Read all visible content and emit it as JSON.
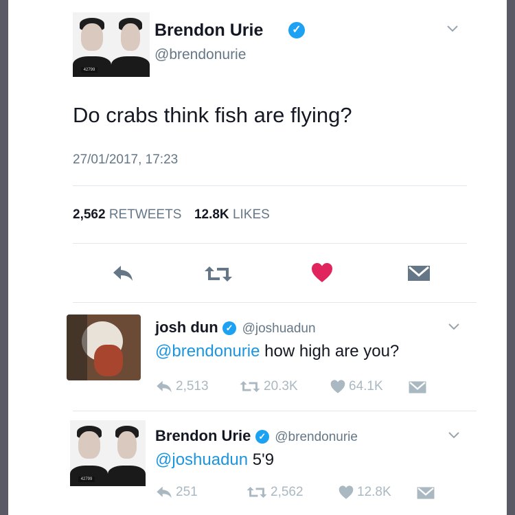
{
  "main_tweet": {
    "author_name": "Brendon Urie",
    "author_handle": "@brendonurie",
    "text": "Do crabs think fish are flying?",
    "timestamp": "27/01/2017, 17:23",
    "retweets_count": "2,562",
    "retweets_label": "RETWEETS",
    "likes_count": "12.8K",
    "likes_label": "LIKES",
    "icons": [
      "reply-icon",
      "retweet-icon",
      "like-icon-filled",
      "direct-message-icon",
      "chevron-down-icon",
      "verified-badge-icon"
    ],
    "colors": {
      "like": "#e0245e",
      "verified": "#1da1f2"
    }
  },
  "reply_1": {
    "author_name": "josh dun",
    "author_handle": "@joshuadun",
    "mention": "@brendonurie",
    "text": " how high are you?",
    "replies": "2,513",
    "retweets": "20.3K",
    "likes": "64.1K"
  },
  "reply_2": {
    "author_name": "Brendon Urie",
    "author_handle": "@brendonurie",
    "mention": "@joshuadun",
    "text": " 5'9",
    "replies": "251",
    "retweets": "2,562",
    "likes": "12.8K"
  },
  "avatar_plate_text": "42799",
  "colors": {
    "mention": "#1b95e0",
    "muted": "#aab8c2",
    "background": "#5a5a66"
  }
}
